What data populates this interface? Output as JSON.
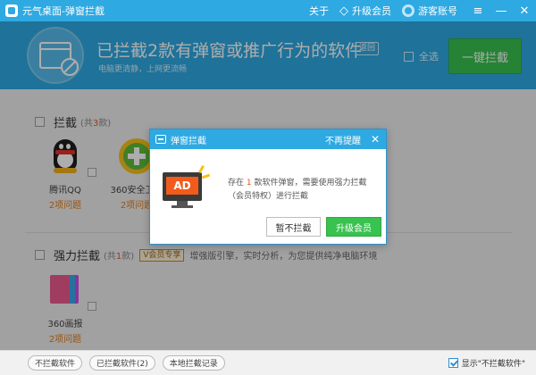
{
  "titlebar": {
    "app_title": "元气桌面-弹窗拦截",
    "about_label": "关于",
    "vip_label": "升级会员",
    "user_name": "游客账号",
    "menu_icon": "hamburger-icon",
    "minimize_icon": "minimize-icon",
    "close_icon": "close-icon"
  },
  "banner": {
    "title": "已拦截2款有弹窗或推广行为的软件",
    "back_label": "返回",
    "subtitle": "电脑更清静，上网更流畅",
    "select_all_label": "全选",
    "block_all_button": "一键拦截"
  },
  "sections": {
    "block": {
      "title": "拦截",
      "count_prefix": "(共",
      "count": "3",
      "count_suffix": "款)",
      "apps": [
        {
          "name": "腾讯QQ",
          "issues": "2项问题",
          "icon": "qq-icon"
        },
        {
          "name": "360安全卫士",
          "issues": "2项问题",
          "icon": "360-safe-icon"
        }
      ]
    },
    "strong": {
      "title": "强力拦截",
      "count_prefix": "(共",
      "count": "1",
      "count_suffix": "款)",
      "vip_badge": "会员专享",
      "description": "增强版引擎，实时分析，为您提供纯净电脑环境",
      "apps": [
        {
          "name": "360画报",
          "issues": "2项问题",
          "icon": "360-pictorial-icon"
        }
      ]
    }
  },
  "dialog": {
    "title": "弹窗拦截",
    "no_remind": "不再提醒",
    "msg_prefix": "存在",
    "msg_count": "1",
    "msg_suffix": "款软件弹窗，需要使用强力拦截",
    "msg_line2": "（会员特权）进行拦截",
    "ad_text": "AD",
    "later_button": "暂不拦截",
    "upgrade_button": "升级会员"
  },
  "bottom": {
    "not_blocked_label": "不拦截软件",
    "blocked_label": "已拦截软件(2)",
    "local_records_label": "本地拦截记录",
    "show_unblocked_label": "显示\"不拦截软件\"",
    "show_unblocked_checked": true
  },
  "colors": {
    "brand_blue": "#2fa9e2",
    "action_green": "#38c24f",
    "issue_orange": "#e07c1b",
    "count_red": "#e05a1e"
  }
}
